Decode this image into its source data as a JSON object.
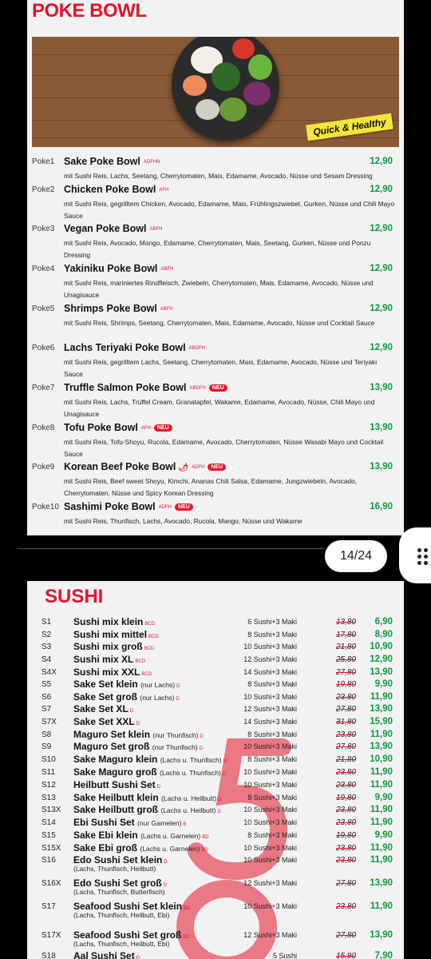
{
  "poke": {
    "title": "POKE BOWL",
    "badge": "Quick & Healthy",
    "items": [
      {
        "code": "Poke1",
        "name": "Sake Poke Bowl",
        "allergens": "ADFHN",
        "price": "12,90",
        "desc": "mit Sushi Reis, Lachs, Seetang, Cherrytomaten, Mais, Edamame, Avocado, Nüsse und Sesam Dressing"
      },
      {
        "code": "Poke2",
        "name": "Chicken Poke Bowl",
        "allergens": "AFH",
        "price": "12,90",
        "desc": "mit Sushi Reis, gegrilltem Chicken, Avocado, Edamame, Mais, Frühlingszwiebel, Gurken, Nüsse und Chili Mayo Sauce"
      },
      {
        "code": "Poke3",
        "name": "Vegan Poke Bowl",
        "allergens": "ABFH",
        "price": "12,90",
        "desc": "mit Sushi Reis, Avocado, Mango, Edamame, Cherrytomaten, Mais, Seetang, Gurken, Nüsse und Ponzu Dressing"
      },
      {
        "code": "Poke4",
        "name": "Yakiniku Poke Bowl",
        "allergens": "ABFH",
        "price": "12,90",
        "desc": "mit Sushi Reis, mariniertes Rindfleisch, Zwiebeln, Cherrytomaten, Mais, Edamame, Avocado, Nüsse und Unagisauce"
      },
      {
        "code": "Poke5",
        "name": "Shrimps Poke Bowl",
        "allergens": "ABFH",
        "price": "12,90",
        "desc": "mit Sushi Reis, Shrimps, Seetang, Cherrytomaten, Mais, Edamame, Avocado, Nüsse und Cocktail Sauce"
      },
      {
        "code": "Poke6",
        "name": "Lachs Teriyaki Poke Bowl",
        "allergens": "ABDFH",
        "price": "12,90",
        "desc": "mit Sushi Reis, gegrilltem Lachs, Seetang, Cherrytomaten, Mais, Edamame, Avocado, Nüsse und Teriyaki Sauce"
      },
      {
        "code": "Poke7",
        "name": "Truffle Salmon Poke Bowl",
        "allergens": "ABDFH",
        "neu": "NEU",
        "price": "13,90",
        "desc": "mit Sushi Reis, Lachs, Trüffel Cream, Granatapfel, Wakame, Edamame, Avocado, Nüsse, Chili Mayo und Unagisauce"
      },
      {
        "code": "Poke8",
        "name": "Tofu Poke Bowl",
        "allergens": "AFH",
        "neu": "NEU",
        "price": "13,90",
        "desc": "mit Sushi Reis, Tofu-Shoyu, Rucola, Edamame, Avocado, Cherrytomaten, Nüsse Wasabi Mayo und Cocktail Sauce"
      },
      {
        "code": "Poke9",
        "name": "Korean Beef Poke Bowl",
        "allergens": "ADFH",
        "chili": true,
        "neu": "NEU",
        "price": "13,90",
        "desc": "mit Sushi Reis, Beef sweet Shoyu, Kimchi, Ananas Chili Salsa, Edamame, Jungzwiebeln, Avocado, Cherrytomaten, Nüsse und Spicy Korean Dressing"
      },
      {
        "code": "Poke10",
        "name": "Sashimi Poke Bowl",
        "allergens": "ADFH",
        "neu": "NEU",
        "price": "16,90",
        "desc": "mit Sushi Reis, Thunfisch, Lachs, Avocado, Rucola, Mango, Nüsse und Wakame"
      }
    ]
  },
  "viewer": {
    "page_indicator": "14/24"
  },
  "sushi": {
    "title": "SUSHI",
    "items": [
      {
        "code": "S1",
        "name": "Sushi mix klein",
        "sub": "",
        "allergens": "BCD",
        "pieces": "6 Sushi+3 Maki",
        "old": "13,80",
        "price": "6,90"
      },
      {
        "code": "S2",
        "name": "Sushi mix mittel",
        "sub": "",
        "allergens": "BCD",
        "pieces": "8 Sushi+3 Maki",
        "old": "17,80",
        "price": "8,90"
      },
      {
        "code": "S3",
        "name": "Sushi mix groß",
        "sub": "",
        "allergens": "BCD",
        "pieces": "10 Sushi+3 Maki",
        "old": "21,80",
        "price": "10,90"
      },
      {
        "code": "S4",
        "name": "Sushi mix XL",
        "sub": "",
        "allergens": "BCD",
        "pieces": "12 Sushi+3 Maki",
        "old": "25,80",
        "price": "12,90"
      },
      {
        "code": "S4X",
        "name": "Sushi mix XXL",
        "sub": "",
        "allergens": "BCD",
        "pieces": "14 Sushi+3 Maki",
        "old": "27,80",
        "price": "13,90"
      },
      {
        "code": "S5",
        "name": "Sake Set klein",
        "sub": "(nur Lachs)",
        "allergens": "D",
        "pieces": "8 Sushi+3 Maki",
        "old": "19,80",
        "price": "9,90"
      },
      {
        "code": "S6",
        "name": "Sake Set groß",
        "sub": "(nur Lachs)",
        "allergens": "D",
        "pieces": "10 Sushi+3 Maki",
        "old": "23,80",
        "price": "11,90"
      },
      {
        "code": "S7",
        "name": "Sake Set XL",
        "sub": "",
        "allergens": "D",
        "pieces": "12 Sushi+3 Maki",
        "old": "27,80",
        "price": "13,90"
      },
      {
        "code": "S7X",
        "name": "Sake Set XXL",
        "sub": "",
        "allergens": "D",
        "pieces": "14 Sushi+3 Maki",
        "old": "31,80",
        "price": "15,90"
      },
      {
        "code": "S8",
        "name": "Maguro Set klein",
        "sub": "(nur Thunfisch)",
        "allergens": "D",
        "pieces": "8 Sushi+3 Maki",
        "old": "23,80",
        "price": "11,90"
      },
      {
        "code": "S9",
        "name": "Maguro Set groß",
        "sub": "(nur Thunfisch)",
        "allergens": "D",
        "pieces": "10 Sushi+3 Maki",
        "old": "27,80",
        "price": "13,90"
      },
      {
        "code": "S10",
        "name": "Sake Maguro klein",
        "sub": "(Lachs u. Thunfisch)",
        "allergens": "D",
        "pieces": "8 Sushi+3 Maki",
        "old": "21,80",
        "price": "10,90"
      },
      {
        "code": "S11",
        "name": "Sake Maguro groß",
        "sub": "(Lachs u. Thunfisch)",
        "allergens": "D",
        "pieces": "10 Sushi+3 Maki",
        "old": "23,80",
        "price": "11,90"
      },
      {
        "code": "S12",
        "name": "Heilbutt Sushi Set",
        "sub": "",
        "allergens": "D",
        "pieces": "10 Sushi+3 Maki",
        "old": "23,80",
        "price": "11,90"
      },
      {
        "code": "S13",
        "name": "Sake Heilbutt klein",
        "sub": "(Lachs u. Heilbutt)",
        "allergens": "D",
        "pieces": "8 Sushi+3 Maki",
        "old": "19,80",
        "price": "9,90"
      },
      {
        "code": "S13X",
        "name": "Sake Heilbutt groß",
        "sub": "(Lachs u. Heilbutt)",
        "allergens": "D",
        "pieces": "10 Sushi+3 Maki",
        "old": "23,80",
        "price": "11,90"
      },
      {
        "code": "S14",
        "name": "Ebi Sushi Set",
        "sub": "(nur Garnelen)",
        "allergens": "B",
        "pieces": "10 Sushi+3 Maki",
        "old": "23,80",
        "price": "11,90"
      },
      {
        "code": "S15",
        "name": "Sake Ebi klein",
        "sub": "(Lachs u. Garnelen)",
        "allergens": "BD",
        "pieces": "8 Sushi+3 Maki",
        "old": "19,80",
        "price": "9,90"
      },
      {
        "code": "S15X",
        "name": "Sake Ebi groß",
        "sub": "(Lachs u. Garnelen)",
        "allergens": "BD",
        "pieces": "10 Sushi+3 Maki",
        "old": "23,80",
        "price": "11,90"
      },
      {
        "code": "S16",
        "name": "Edo Sushi Set klein",
        "sub": "",
        "allergens": "D",
        "desc": "(Lachs, Thunfisch, Heilbutt)",
        "pieces": "10 Sushi+3 Maki",
        "old": "23,80",
        "price": "11,90"
      },
      {
        "code": "S16X",
        "name": "Edo Sushi Set groß",
        "sub": "",
        "allergens": "D",
        "desc": "(Lachs, Thunfisch, Butterfisch)",
        "pieces": "12 Sushi+3 Maki",
        "old": "27,80",
        "price": "13,90"
      },
      {
        "code": "S17",
        "name": "Seafood Sushi Set klein",
        "sub": "",
        "allergens": "BD",
        "desc": "(Lachs, Thunfisch, Heilbutt, Ebi)",
        "pieces": "10 Sushi+3 Maki",
        "old": "23,80",
        "price": "11,90"
      },
      {
        "code": "S17X",
        "name": "Seafood Sushi Set groß",
        "sub": "",
        "allergens": "BD",
        "desc": "(Lachs, Thunfisch, Heilbutt, Ebi)",
        "pieces": "12 Sushi+3 Maki",
        "old": "27,80",
        "price": "13,90"
      },
      {
        "code": "S18",
        "name": "Aal Sushi Set",
        "sub": "",
        "allergens": "D",
        "pieces": "5 Sushi",
        "old": "15,80",
        "price": "7,90"
      }
    ]
  },
  "colors": {
    "brand_red": "#e3142c",
    "price_green": "#0a9a3a",
    "badge_yellow": "#f3e53b"
  }
}
